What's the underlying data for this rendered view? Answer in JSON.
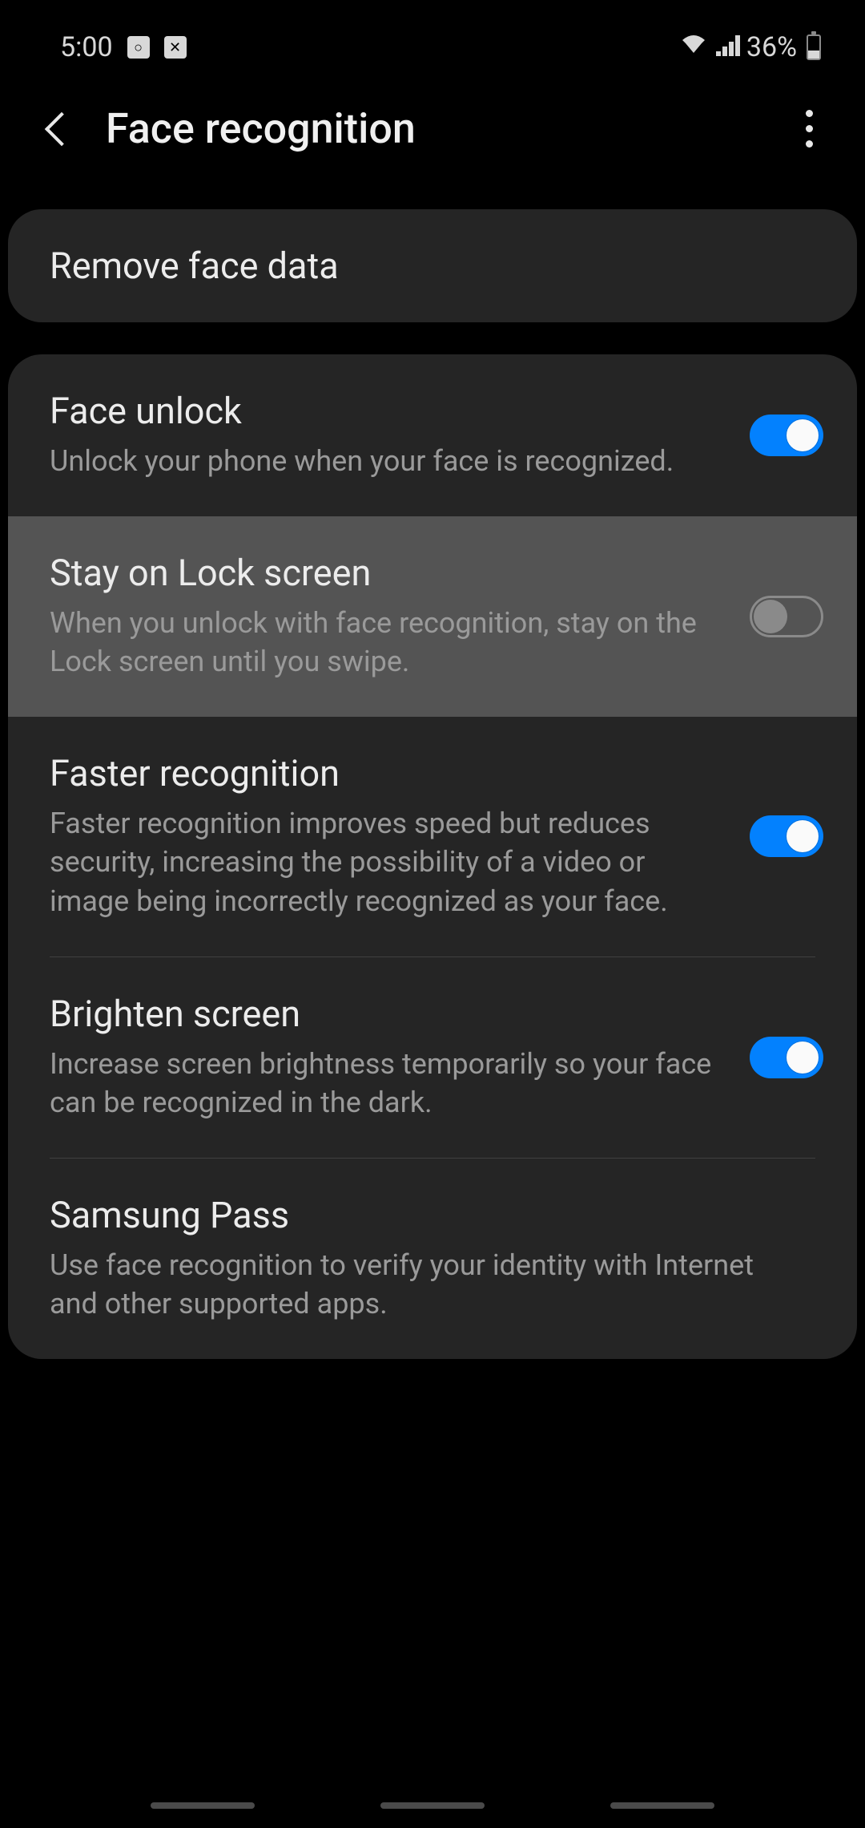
{
  "status": {
    "time": "5:00",
    "battery_percent": "36%"
  },
  "header": {
    "title": "Face recognition"
  },
  "remove_face": {
    "label": "Remove face data"
  },
  "settings": [
    {
      "title": "Face unlock",
      "subtitle": "Unlock your phone when your face is recognized.",
      "toggle": true,
      "highlighted": false
    },
    {
      "title": "Stay on Lock screen",
      "subtitle": "When you unlock with face recognition, stay on the Lock screen until you swipe.",
      "toggle": false,
      "highlighted": true
    },
    {
      "title": "Faster recognition",
      "subtitle": "Faster recognition improves speed but reduces security, increasing the possibility of a video or image being incorrectly recognized as your face.",
      "toggle": true,
      "highlighted": false
    },
    {
      "title": "Brighten screen",
      "subtitle": "Increase screen brightness temporarily so your face can be recognized in the dark.",
      "toggle": true,
      "highlighted": false
    },
    {
      "title": "Samsung Pass",
      "subtitle": "Use face recognition to verify your identity with Internet and other supported apps.",
      "toggle": null,
      "highlighted": false
    }
  ]
}
